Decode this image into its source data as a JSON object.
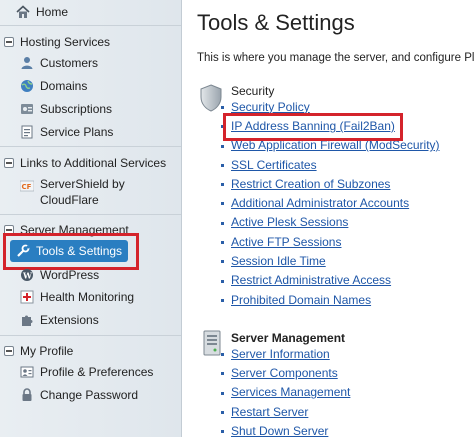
{
  "sidebar": {
    "home": "Home",
    "sections": [
      {
        "title": "Hosting Services",
        "items": [
          "Customers",
          "Domains",
          "Subscriptions",
          "Service Plans"
        ]
      },
      {
        "title": "Links to Additional Services",
        "items": [
          "ServerShield by CloudFlare"
        ]
      },
      {
        "title": "Server Management",
        "items": [
          "Tools & Settings",
          "WordPress",
          "Health Monitoring",
          "Extensions"
        ]
      },
      {
        "title": "My Profile",
        "items": [
          "Profile & Preferences",
          "Change Password"
        ]
      }
    ],
    "servershield_line1": "ServerShield by",
    "servershield_line2": "CloudFlare"
  },
  "main": {
    "title": "Tools & Settings",
    "intro": "This is where you manage the server, and configure Pl",
    "security": {
      "title": "Security",
      "links": [
        "Security Policy",
        "IP Address Banning (Fail2Ban)",
        "Web Application Firewall (ModSecurity)",
        "SSL Certificates",
        "Restrict Creation of Subzones",
        "Additional Administrator Accounts",
        "Active Plesk Sessions",
        "Active FTP Sessions",
        "Session Idle Time",
        "Restrict Administrative Access",
        "Prohibited Domain Names"
      ]
    },
    "server_management": {
      "title": "Server Management",
      "links": [
        "Server Information",
        "Server Components",
        "Services Management",
        "Restart Server",
        "Shut Down Server"
      ]
    }
  },
  "colors": {
    "accent": "#2a7ec1",
    "highlight": "#d4232b",
    "link": "#1f57a8"
  }
}
